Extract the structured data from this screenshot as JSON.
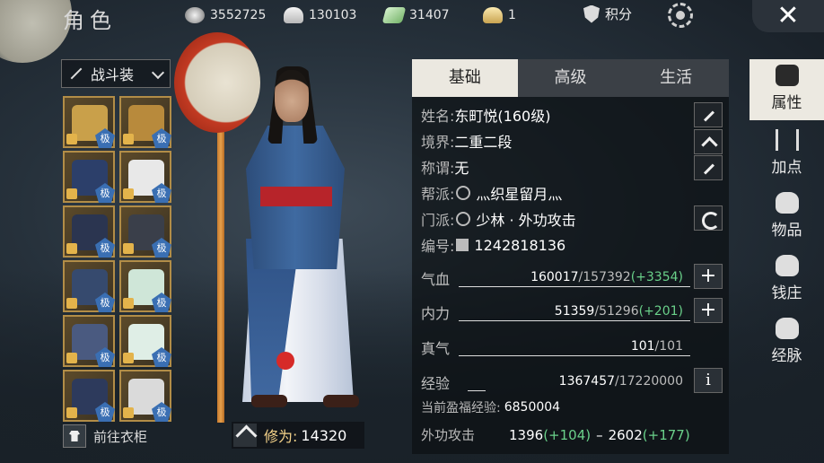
{
  "header": {
    "title": "角色",
    "currencies": [
      {
        "icon": "silver-coin-icon",
        "value": "3552725"
      },
      {
        "icon": "silver-ingot-icon",
        "value": "130103"
      },
      {
        "icon": "jade-ticket-icon",
        "value": "31407"
      },
      {
        "icon": "gold-ingot-icon",
        "value": "1"
      }
    ],
    "score_label": "积分"
  },
  "outfit": {
    "selected": "战斗装"
  },
  "equipment": {
    "badge": "极",
    "slots": [
      {
        "icon": "spear-icon"
      },
      {
        "icon": "dagger-icon"
      },
      {
        "icon": "hat-icon"
      },
      {
        "icon": "necklace-icon"
      },
      {
        "icon": "armor-icon"
      },
      {
        "icon": "gauntlet-icon"
      },
      {
        "icon": "belt-icon"
      },
      {
        "icon": "bracelet-icon"
      },
      {
        "icon": "pants-icon"
      },
      {
        "icon": "jade-ring-icon"
      },
      {
        "icon": "boots-icon"
      },
      {
        "icon": "pendant-icon"
      }
    ]
  },
  "wardrobe_label": "前往衣柜",
  "cultivation": {
    "label": "修为:",
    "value": "14320"
  },
  "panel": {
    "tabs": [
      "基础",
      "高级",
      "生活"
    ],
    "name_label": "姓名:",
    "name_value": "东町悦(160级)",
    "realm_label": "境界:",
    "realm_value": "二重二段",
    "title_label": "称谓:",
    "title_value": "无",
    "guild_label": "帮派:",
    "guild_value": "灬织星留月灬",
    "sect_label": "门派:",
    "sect_value": "少林 · 外功攻击",
    "id_label": "编号:",
    "id_value": "1242818136",
    "hp": {
      "label": "气血",
      "current": "160017",
      "max": "157392",
      "bonus": "(+3354)"
    },
    "mp": {
      "label": "内力",
      "current": "51359",
      "max": "51296",
      "bonus": "(+201)"
    },
    "qi": {
      "label": "真气",
      "current": "101",
      "max": "101"
    },
    "xp": {
      "label": "经验",
      "current": "1367457",
      "max": "17220000",
      "info": "i"
    },
    "bonus_xp_label": "当前盈福经验:",
    "bonus_xp_value": "6850004",
    "attack": {
      "label": "外功攻击",
      "min": "1396",
      "min_bonus": "(+104)",
      "dash": "–",
      "max": "2602",
      "max_bonus": "(+177)"
    }
  },
  "side_menu": [
    {
      "label": "属性",
      "icon": "attribute-icon",
      "active": true
    },
    {
      "label": "加点",
      "icon": "sliders-icon",
      "active": false
    },
    {
      "label": "物品",
      "icon": "bag-icon",
      "active": false
    },
    {
      "label": "钱庄",
      "icon": "money-bag-icon",
      "active": false
    },
    {
      "label": "经脉",
      "icon": "meridian-bag-icon",
      "active": false
    }
  ]
}
